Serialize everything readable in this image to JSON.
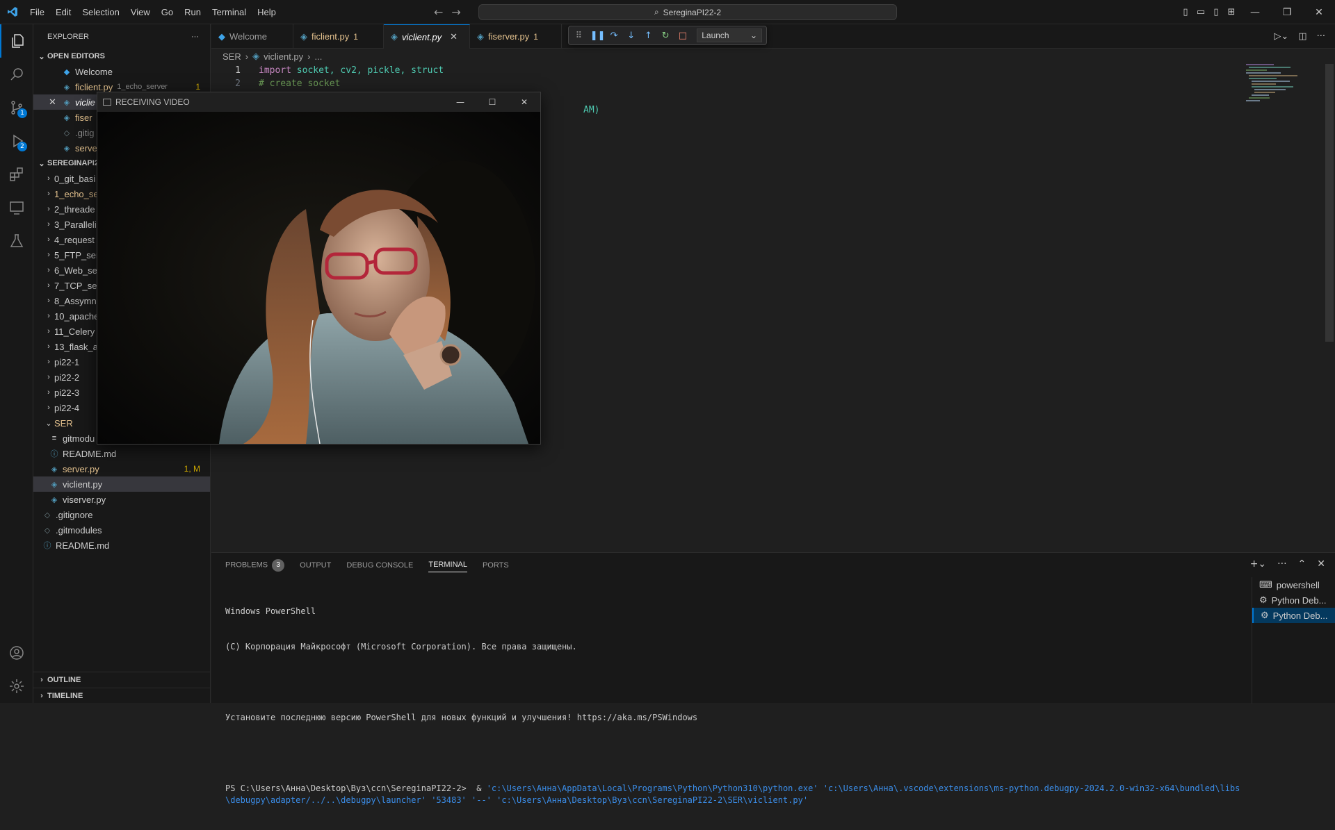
{
  "titlebar": {
    "menu": [
      "File",
      "Edit",
      "Selection",
      "View",
      "Go",
      "Run",
      "Terminal",
      "Help"
    ],
    "search": "SereginaPI22-2"
  },
  "activitybar": {
    "scm_badge": "1",
    "debug_badge": "2"
  },
  "sidebar": {
    "title": "EXPLORER",
    "open_editors_label": "OPEN EDITORS",
    "open_editors": [
      {
        "name": "Welcome",
        "desc": "",
        "badge": ""
      },
      {
        "name": "ficlient.py",
        "desc": "1_echo_server",
        "badge": "1"
      },
      {
        "name": "viclie",
        "desc": "",
        "badge": ""
      },
      {
        "name": "fiser",
        "desc": "",
        "badge": ""
      },
      {
        "name": ".gitig",
        "desc": "",
        "badge": ""
      },
      {
        "name": "serve",
        "desc": "",
        "badge": ""
      }
    ],
    "workspace_label": "SEREGINAPI2",
    "folders": [
      "0_git_basi",
      "1_echo_se",
      "2_threade",
      "3_Paralleli",
      "4_request",
      "5_FTP_ser",
      "6_Web_se",
      "7_TCP_ser",
      "8_Assymn",
      "10_apache",
      "11_Celery",
      "13_flask_a",
      "pi22-1",
      "pi22-2",
      "pi22-3",
      "pi22-4"
    ],
    "ser_folder": "SER",
    "ser_files": [
      {
        "name": "gitmodu",
        "badge": ""
      },
      {
        "name": "README.md",
        "badge": ""
      },
      {
        "name": "server.py",
        "badge": "1, M"
      },
      {
        "name": "viclient.py",
        "badge": ""
      },
      {
        "name": "viserver.py",
        "badge": ""
      }
    ],
    "root_files": [
      ".gitignore",
      ".gitmodules",
      "README.md"
    ],
    "outline": "OUTLINE",
    "timeline": "TIMELINE"
  },
  "tabs": [
    {
      "label": "Welcome",
      "count": ""
    },
    {
      "label": "ficlient.py",
      "count": "1"
    },
    {
      "label": "viclient.py",
      "count": ""
    },
    {
      "label": "fiserver.py",
      "count": "1"
    }
  ],
  "debug": {
    "config": "Launch"
  },
  "breadcrumb": {
    "folder": "SER",
    "file": "viclient.py",
    "rest": "..."
  },
  "code": {
    "line1_num": "1",
    "line2_num": "2",
    "line1_kw": "import",
    "line1_mods": "socket, cv2, pickle, struct",
    "line2": "# create socket",
    "line4_tail": "AM)"
  },
  "panel": {
    "tabs": [
      "PROBLEMS",
      "OUTPUT",
      "DEBUG CONSOLE",
      "TERMINAL",
      "PORTS"
    ],
    "problems_count": "3",
    "terminal_lines": [
      "Windows PowerShell",
      "(C) Корпорация Майкрософт (Microsoft Corporation). Все права защищены.",
      "",
      "Установите последнюю версию PowerShell для новых функций и улучшения! https://aka.ms/PSWindows",
      ""
    ],
    "prompt": "PS C:\\Users\\Анна\\Desktop\\Вуз\\ccn\\SereginaPI22-2>  & ",
    "command": "'c:\\Users\\Анна\\AppData\\Local\\Programs\\Python\\Python310\\python.exe' 'c:\\Users\\Анна\\.vscode\\extensions\\ms-python.debugpy-2024.2.0-win32-x64\\bundled\\libs\\debugpy\\adapter/../..\\debugpy\\launcher' '53483' '--' 'c:\\Users\\Анна\\Desktop\\Вуз\\ccn\\SereginaPI22-2\\SER\\viclient.py'",
    "terminals": [
      "powershell",
      "Python Deb...",
      "Python Deb..."
    ]
  },
  "video_window": {
    "title": "RECEIVING VIDEO"
  },
  "colors": {
    "accent": "#0078d4",
    "modified": "#e2c08d",
    "python_icon": "#519aba"
  }
}
